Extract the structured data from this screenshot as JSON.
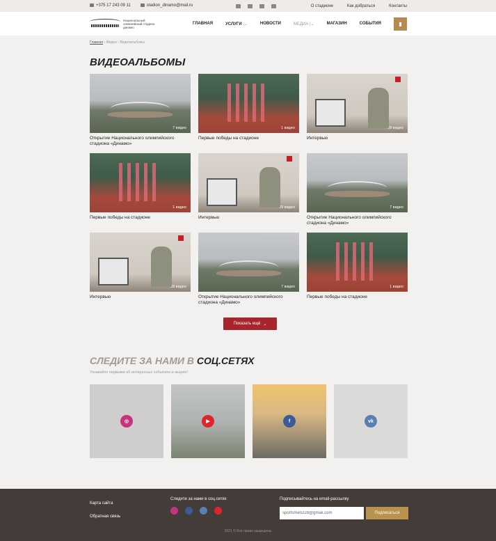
{
  "topbar": {
    "phone": "+375 17 243 09 11",
    "email": "stadion_dinamo@mail.ru",
    "links": [
      "О стадионе",
      "Как добраться",
      "Контакты"
    ]
  },
  "header": {
    "logo_text": "Национальный олимпийский стадион динамо",
    "nav": [
      "ГЛАВНАЯ",
      "УСЛУГИ",
      "НОВОСТИ",
      "МЕДИА",
      "МАГАЗИН",
      "СОБЫТИЯ"
    ]
  },
  "breadcrumbs": [
    "Главная",
    "Медиа",
    "Видеоальбомы"
  ],
  "page_title": "ВИДЕОАЛЬБОМЫ",
  "albums": [
    {
      "kind": "stadium",
      "count": "7 видео",
      "title": "Открытие Национального олимпийского стадиона «Динамо»"
    },
    {
      "kind": "runners",
      "count": "1 видео",
      "title": "Первые победы на стадионе"
    },
    {
      "kind": "interview",
      "count": "39 видео",
      "title": "Интервью"
    },
    {
      "kind": "runners",
      "count": "1 видео",
      "title": "Первые победы на стадионе"
    },
    {
      "kind": "interview",
      "count": "39 видео",
      "title": "Интервью"
    },
    {
      "kind": "stadium",
      "count": "7 видео",
      "title": "Открытие Национального олимпийского стадиона «Динамо»"
    },
    {
      "kind": "interview",
      "count": "39 видео",
      "title": "Интервью"
    },
    {
      "kind": "stadium",
      "count": "7 видео",
      "title": "Открытие Национального олимпийского стадиона «Динамо»"
    },
    {
      "kind": "runners",
      "count": "1 видео",
      "title": "Первые победы на стадионе"
    }
  ],
  "more_button": "Показать ещё",
  "social_section": {
    "title_a": "СЛЕДИТЕ ЗА НАМИ В",
    "title_b": "СОЦ.СЕТЯХ",
    "subtitle": "Узнавайте первыми об интересных событиях и акциях!",
    "cards": [
      {
        "network": "instagram",
        "color": "#c2347f"
      },
      {
        "network": "youtube",
        "color": "#e0242c"
      },
      {
        "network": "facebook",
        "color": "#3d5a98"
      },
      {
        "network": "vk",
        "color": "#5b7fb3"
      }
    ]
  },
  "footer": {
    "links": [
      "Карта сайта",
      "Обратная связь"
    ],
    "follow_label": "Следите за нами в соц.сетях",
    "newsletter_label": "Подписывайтесь на email-рассылку",
    "email_value": "sportsmen228@gmail.com",
    "subscribe_button": "Подписаться",
    "copyright": "2021 © Все права защищены"
  }
}
